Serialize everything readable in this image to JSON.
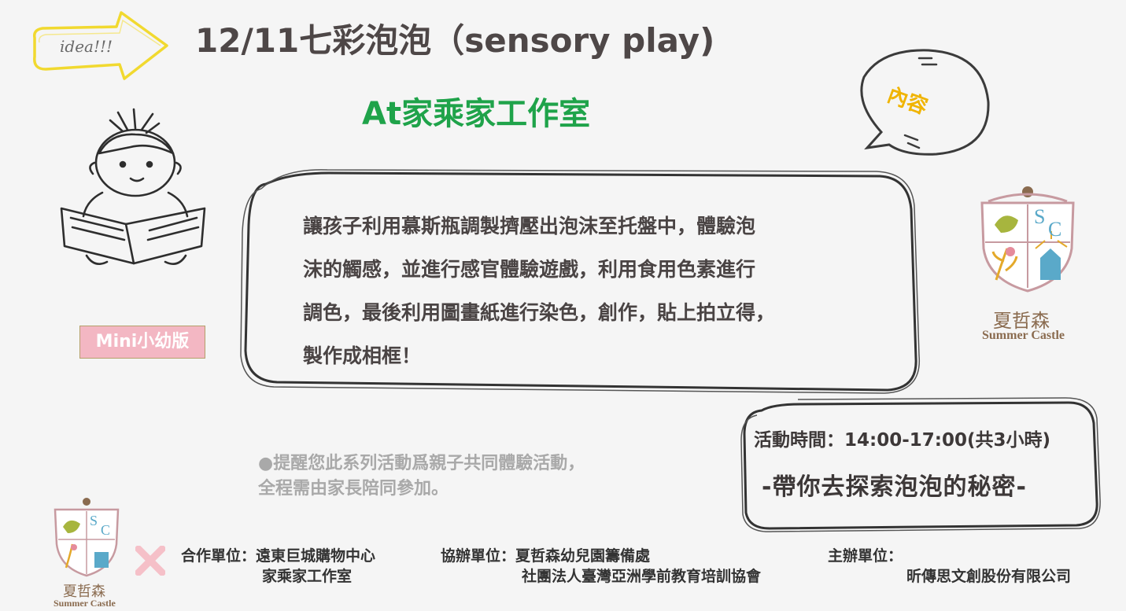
{
  "header": {
    "idea_label": "idea!!!",
    "title": "12/11七彩泡泡（sensory play)",
    "venue": "At家乘家工作室",
    "bubble_label": "內容"
  },
  "content": {
    "description_lines": [
      "讓孩子利用慕斯瓶調製擠壓出泡沫至托盤中，體驗泡",
      "沫的觸感，並進行感官體驗遊戲，利用食用色素進行",
      "調色，最後利用圖畫紙進行染色，創作，貼上拍立得，",
      "製作成相框！"
    ]
  },
  "badge": {
    "label": "Mini小幼版"
  },
  "reminder": {
    "line1": "●提醒您此系列活動爲親子共同體驗活動，",
    "line2": "全程需由家長陪同參加。"
  },
  "schedule": {
    "time": "活動時間：14:00-17:00(共3小時)",
    "tagline": "-帶你去探索泡泡的秘密-"
  },
  "brand": {
    "name_cn": "夏哲森",
    "name_en": "Summer Castle",
    "monogram_s": "S",
    "monogram_c": "C"
  },
  "footer": {
    "partner_label": "合作單位：遠東巨城購物中心",
    "partner_line2": "家乘家工作室",
    "coorganizer_label": "協辦單位：夏哲森幼兒園籌備處",
    "coorganizer_line2": "社團法人臺灣亞洲學前教育培訓協會",
    "organizer_label": "主辦單位：",
    "organizer_line2": "昕傳思文創股份有限公司"
  },
  "colors": {
    "title": "#4e4747",
    "venue": "#1fa34a",
    "bubble_text": "#f0b400",
    "badge_bg": "#f3b7c3",
    "reminder": "#a9a9a9",
    "idea_arrow": "#f5e04a",
    "cross": "#f5c0c8"
  }
}
